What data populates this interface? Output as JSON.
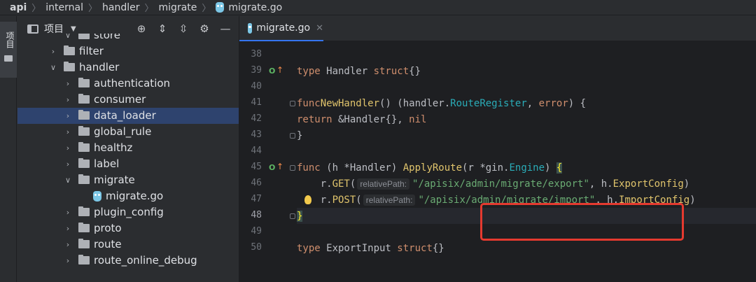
{
  "breadcrumb": [
    "api",
    "internal",
    "handler",
    "migrate",
    "migrate.go"
  ],
  "toolstrip": {
    "project_label": "项目"
  },
  "project_panel": {
    "title": "项目",
    "tools": [
      "target-icon",
      "expand-all-icon",
      "collapse-all-icon",
      "gear-icon",
      "minimize-icon"
    ]
  },
  "tree": [
    {
      "label": "store",
      "level": 1,
      "expanded": true,
      "type": "folder",
      "partial": true
    },
    {
      "label": "filter",
      "level": 0,
      "expanded": false,
      "type": "folder"
    },
    {
      "label": "handler",
      "level": 0,
      "expanded": true,
      "type": "folder"
    },
    {
      "label": "authentication",
      "level": 1,
      "expanded": false,
      "type": "folder"
    },
    {
      "label": "consumer",
      "level": 1,
      "expanded": false,
      "type": "folder"
    },
    {
      "label": "data_loader",
      "level": 1,
      "expanded": false,
      "type": "folder",
      "selected": true
    },
    {
      "label": "global_rule",
      "level": 1,
      "expanded": false,
      "type": "folder"
    },
    {
      "label": "healthz",
      "level": 1,
      "expanded": false,
      "type": "folder"
    },
    {
      "label": "label",
      "level": 1,
      "expanded": false,
      "type": "folder"
    },
    {
      "label": "migrate",
      "level": 1,
      "expanded": true,
      "type": "folder"
    },
    {
      "label": "migrate.go",
      "level": 2,
      "type": "gofile"
    },
    {
      "label": "plugin_config",
      "level": 1,
      "expanded": false,
      "type": "folder"
    },
    {
      "label": "proto",
      "level": 1,
      "expanded": false,
      "type": "folder"
    },
    {
      "label": "route",
      "level": 1,
      "expanded": false,
      "type": "folder"
    },
    {
      "label": "route_online_debug",
      "level": 1,
      "expanded": false,
      "type": "folder"
    }
  ],
  "editor": {
    "tab": "migrate.go",
    "current_line": 48,
    "lines": [
      {
        "n": "38",
        "code": ""
      },
      {
        "n": "39",
        "code": "type Handler struct{}"
      },
      {
        "n": "40",
        "code": ""
      },
      {
        "n": "41",
        "code": "func NewHandler() (handler.RouteRegister, error) {"
      },
      {
        "n": "42",
        "code": "    return &Handler{}, nil"
      },
      {
        "n": "43",
        "code": "}"
      },
      {
        "n": "44",
        "code": ""
      },
      {
        "n": "45",
        "code": "func (h *Handler) ApplyRoute(r *gin.Engine) {"
      },
      {
        "n": "46",
        "code": "    r.GET( relativePath: \"/apisix/admin/migrate/export\", h.ExportConfig)"
      },
      {
        "n": "47",
        "code": "    r.POST( relativePath: \"/apisix/admin/migrate/import\", h.ImportConfig)"
      },
      {
        "n": "48",
        "code": "}"
      },
      {
        "n": "49",
        "code": ""
      },
      {
        "n": "50",
        "code": "type ExportInput struct{}"
      }
    ],
    "inlay_hint": "relativePath:",
    "route_export": "\"/apisix/admin/migrate/export\"",
    "route_import": "\"/apisix/admin/migrate/import\""
  },
  "colors": {
    "highlight_box": "#e53a2f",
    "selection": "#2e436e",
    "accent": "#3574f0"
  }
}
